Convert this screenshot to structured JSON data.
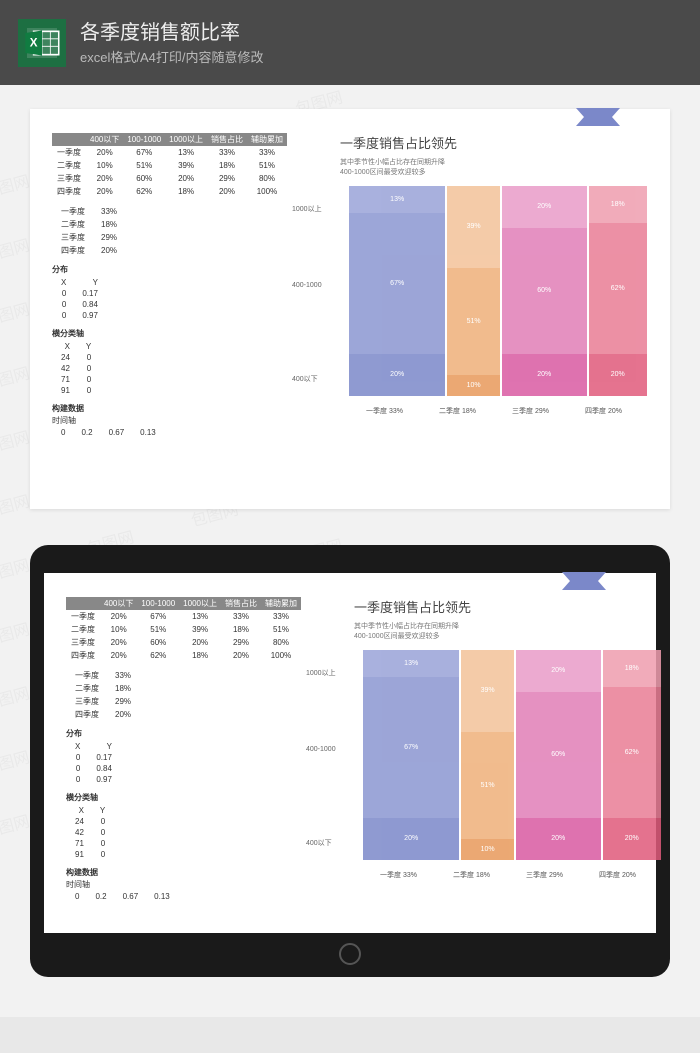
{
  "header": {
    "title": "各季度销售额比率",
    "subtitle": "excel格式/A4打印/内容随意修改",
    "icon_label": "excel-icon"
  },
  "watermark_text": "包图网",
  "table_main": {
    "headers": [
      "",
      "400以下",
      "100-1000",
      "1000以上",
      "销售占比",
      "辅助累加"
    ],
    "rows": [
      [
        "一季度",
        "20%",
        "67%",
        "13%",
        "33%",
        "33%"
      ],
      [
        "二季度",
        "10%",
        "51%",
        "39%",
        "18%",
        "51%"
      ],
      [
        "三季度",
        "20%",
        "60%",
        "20%",
        "29%",
        "80%"
      ],
      [
        "四季度",
        "20%",
        "62%",
        "18%",
        "20%",
        "100%"
      ]
    ]
  },
  "table_pct": {
    "rows": [
      [
        "一季度",
        "33%"
      ],
      [
        "二季度",
        "18%"
      ],
      [
        "三季度",
        "29%"
      ],
      [
        "四季度",
        "20%"
      ]
    ]
  },
  "dist": {
    "label": "分布",
    "head": [
      "X",
      "Y"
    ],
    "rows": [
      [
        "0",
        "0.17"
      ],
      [
        "0",
        "0.84"
      ],
      [
        "0",
        "0.97"
      ]
    ]
  },
  "axis": {
    "label": "横分类轴",
    "head": [
      "X",
      "Y"
    ],
    "rows": [
      [
        "24",
        "0"
      ],
      [
        "42",
        "0"
      ],
      [
        "71",
        "0"
      ],
      [
        "91",
        "0"
      ]
    ]
  },
  "build": {
    "label": "构建数据",
    "sublabel": "时间轴",
    "row": [
      "0",
      "0.2",
      "0.67",
      "0.13"
    ]
  },
  "chart": {
    "title": "一季度销售占比领先",
    "sub1": "其中季节性小幅占比存在同期升降",
    "sub2": "400-1000区间最受欢迎较多"
  },
  "chart_data": {
    "type": "bar",
    "stacked": true,
    "categories": [
      "一季度 33%",
      "二季度 18%",
      "三季度 29%",
      "四季度 20%"
    ],
    "y_labels": [
      "400以下",
      "400-1000",
      "1000以上"
    ],
    "series": [
      {
        "name": "400以下",
        "values": [
          20,
          10,
          20,
          20
        ],
        "colors": [
          "#7b88c9",
          "#e89a5b",
          "#d95aa2",
          "#e05a7b"
        ]
      },
      {
        "name": "400-1000",
        "values": [
          67,
          51,
          60,
          62
        ],
        "colors": [
          "#8b96d1",
          "#efb07a",
          "#e17eb7",
          "#e97d95"
        ]
      },
      {
        "name": "1000以上",
        "values": [
          13,
          39,
          20,
          18
        ],
        "colors": [
          "#9aa3d8",
          "#f3c299",
          "#e99cc8",
          "#ef9daf"
        ]
      }
    ],
    "widths": [
      33,
      18,
      29,
      20
    ],
    "title": "一季度销售占比领先",
    "xlabel": "",
    "ylabel": ""
  }
}
